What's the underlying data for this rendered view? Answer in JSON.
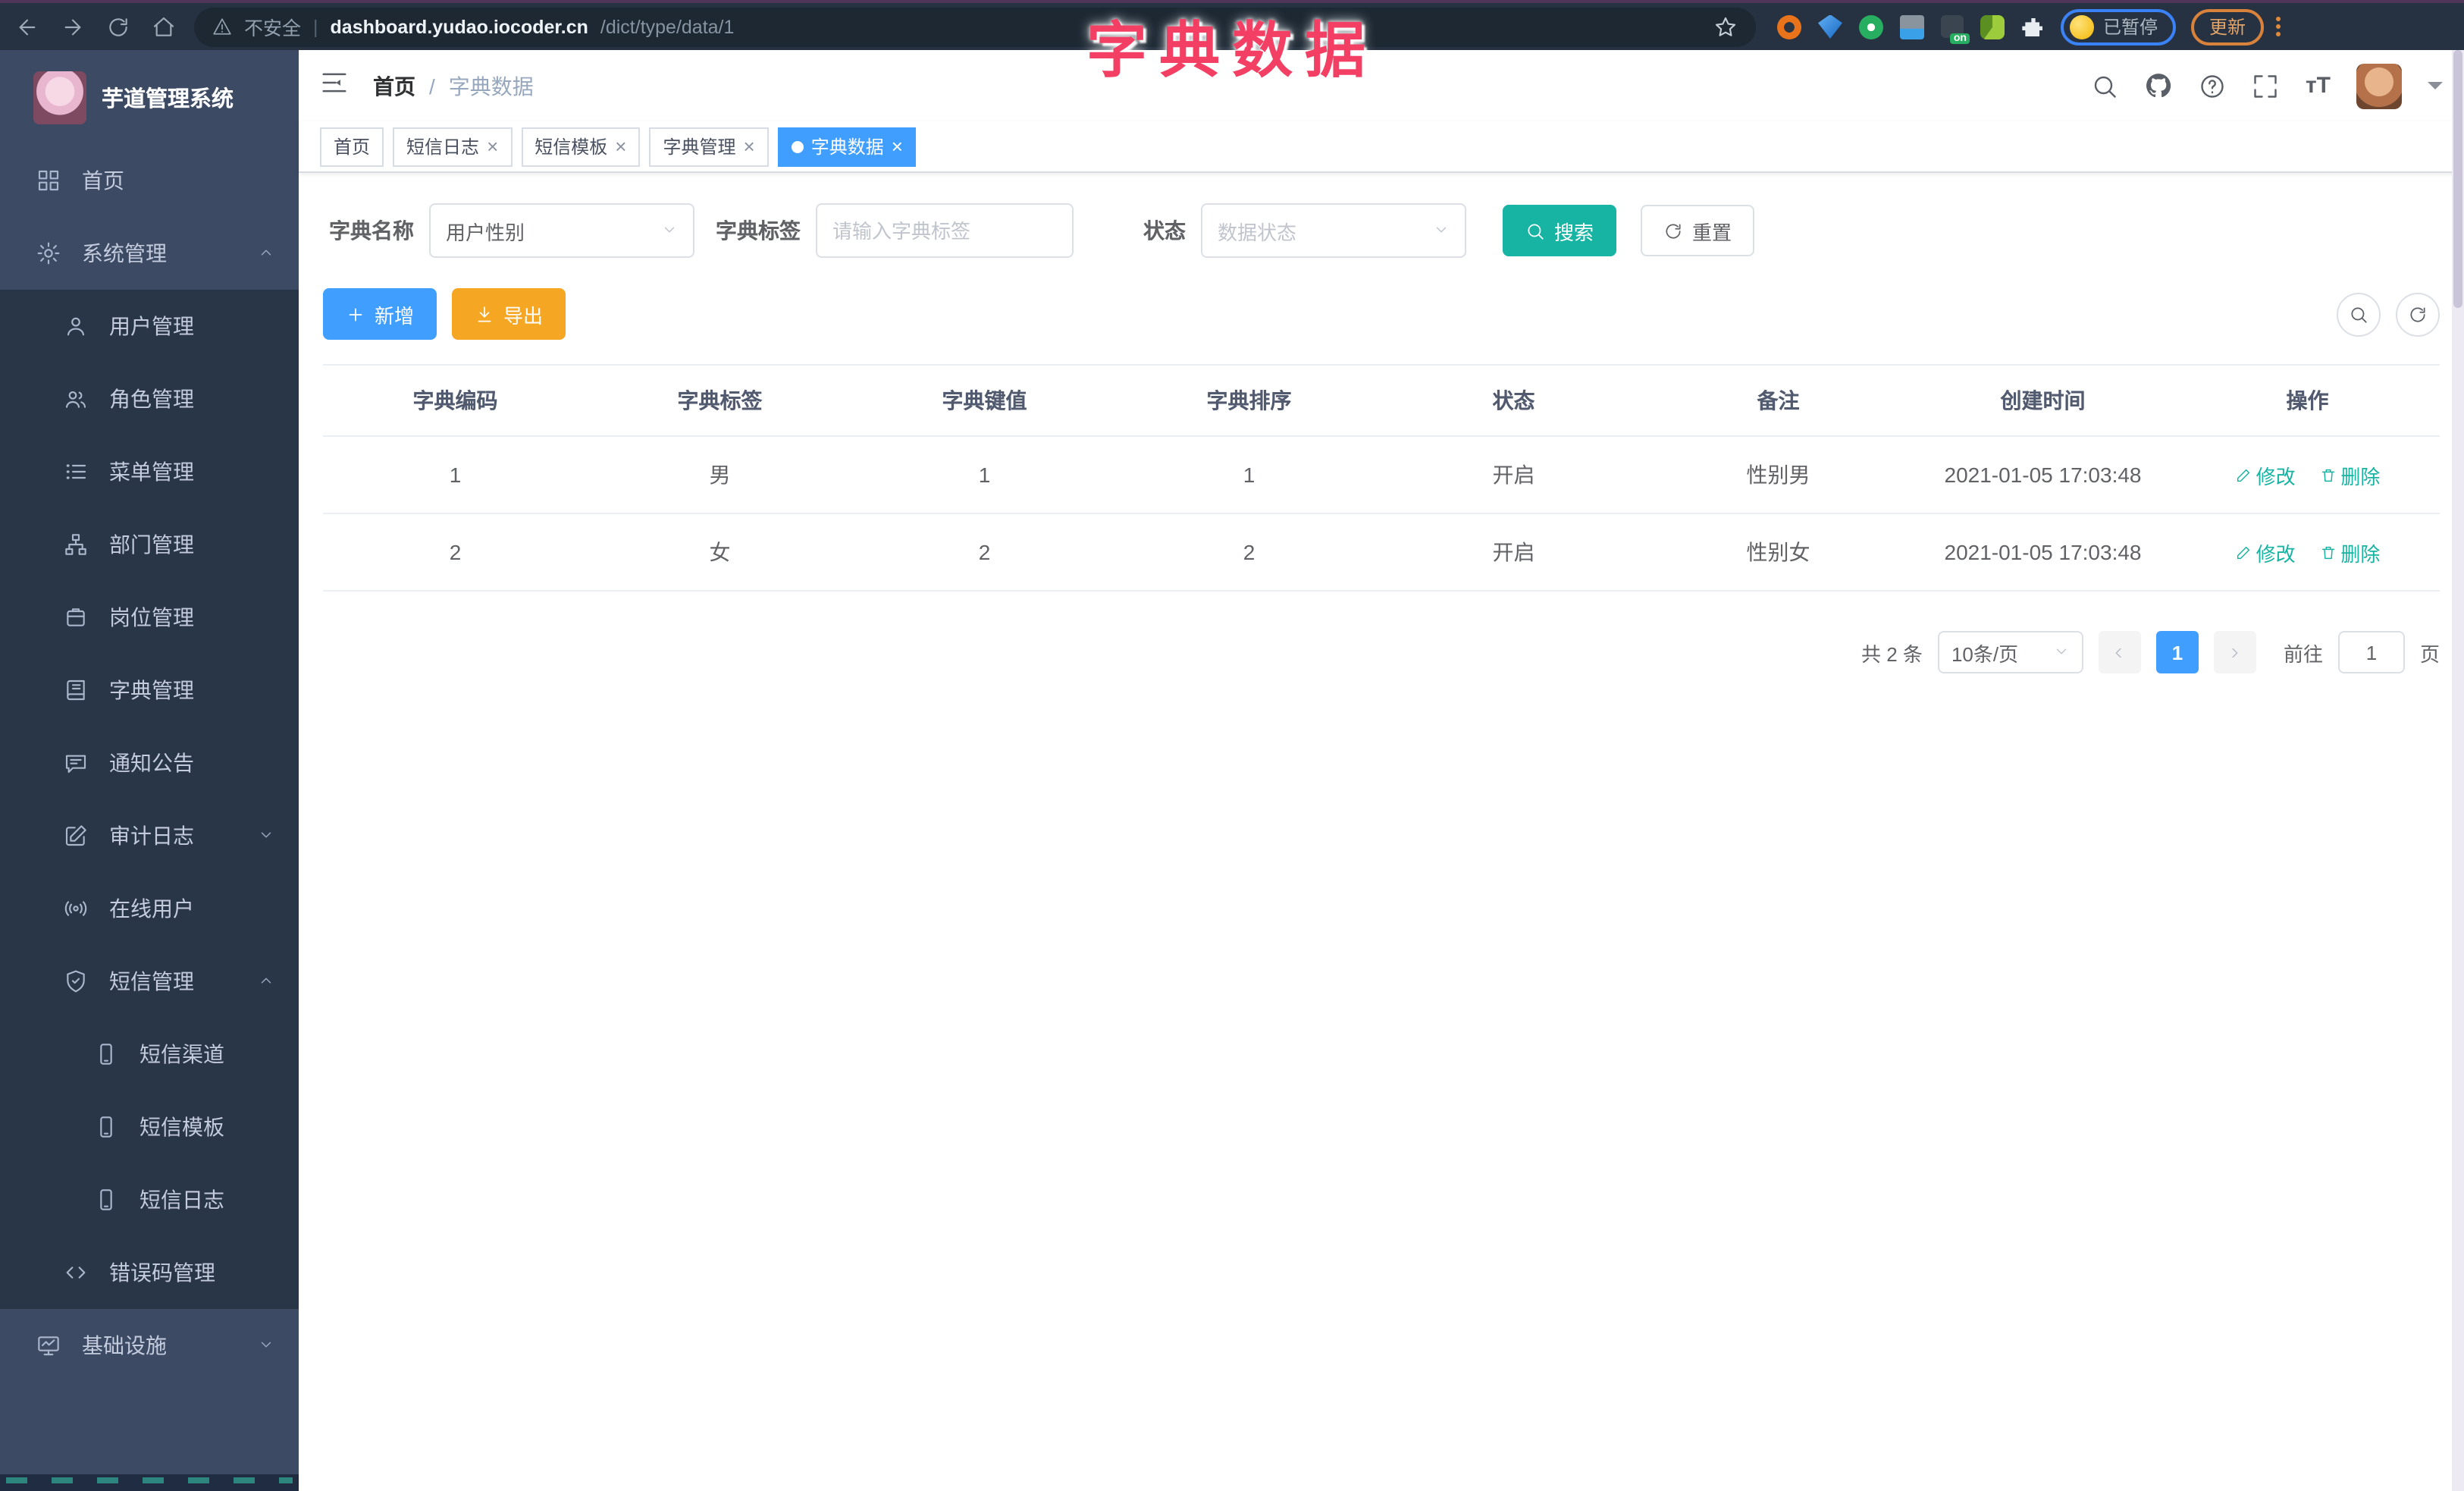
{
  "overlay_title": "字典数据",
  "browser": {
    "security_label": "不安全",
    "url_host": "dashboard.yudao.iocoder.cn",
    "url_path": "/dict/type/data/1",
    "paused_label": "已暂停",
    "update_label": "更新"
  },
  "sidebar": {
    "logo_title": "芋道管理系统",
    "items": [
      {
        "label": "首页"
      },
      {
        "label": "系统管理"
      },
      {
        "label": "用户管理"
      },
      {
        "label": "角色管理"
      },
      {
        "label": "菜单管理"
      },
      {
        "label": "部门管理"
      },
      {
        "label": "岗位管理"
      },
      {
        "label": "字典管理"
      },
      {
        "label": "通知公告"
      },
      {
        "label": "审计日志"
      },
      {
        "label": "在线用户"
      },
      {
        "label": "短信管理"
      },
      {
        "label": "短信渠道"
      },
      {
        "label": "短信模板"
      },
      {
        "label": "短信日志"
      },
      {
        "label": "错误码管理"
      },
      {
        "label": "基础设施"
      }
    ]
  },
  "header": {
    "breadcrumb_home": "首页",
    "breadcrumb_sep": "/",
    "breadcrumb_current": "字典数据"
  },
  "tags": [
    {
      "label": "首页"
    },
    {
      "label": "短信日志"
    },
    {
      "label": "短信模板"
    },
    {
      "label": "字典管理"
    },
    {
      "label": "字典数据"
    }
  ],
  "filters": {
    "dict_name_label": "字典名称",
    "dict_name_value": "用户性别",
    "dict_label_label": "字典标签",
    "dict_label_placeholder": "请输入字典标签",
    "status_label": "状态",
    "status_placeholder": "数据状态",
    "search_label": "搜索",
    "reset_label": "重置"
  },
  "actions": {
    "add_label": "新增",
    "export_label": "导出"
  },
  "table": {
    "columns": [
      "字典编码",
      "字典标签",
      "字典键值",
      "字典排序",
      "状态",
      "备注",
      "创建时间",
      "操作"
    ],
    "rows": [
      {
        "code": "1",
        "label": "男",
        "value": "1",
        "sort": "1",
        "status": "开启",
        "remark": "性别男",
        "created": "2021-01-05 17:03:48"
      },
      {
        "code": "2",
        "label": "女",
        "value": "2",
        "sort": "2",
        "status": "开启",
        "remark": "性别女",
        "created": "2021-01-05 17:03:48"
      }
    ],
    "edit_label": "修改",
    "delete_label": "删除"
  },
  "pagination": {
    "total": "共 2 条",
    "page_size": "10条/页",
    "current_page": "1",
    "goto_label": "前往",
    "goto_value": "1",
    "page_suffix": "页"
  },
  "colors": {
    "primary_blue": "#409eff",
    "teal_accent": "#17b3a3",
    "warning_yellow": "#f5a623",
    "annotation_pink": "#f23f63",
    "sidebar_bg": "#3c4a64",
    "sidebar_submenu_bg": "#293648",
    "chrome_bg": "#263241"
  }
}
